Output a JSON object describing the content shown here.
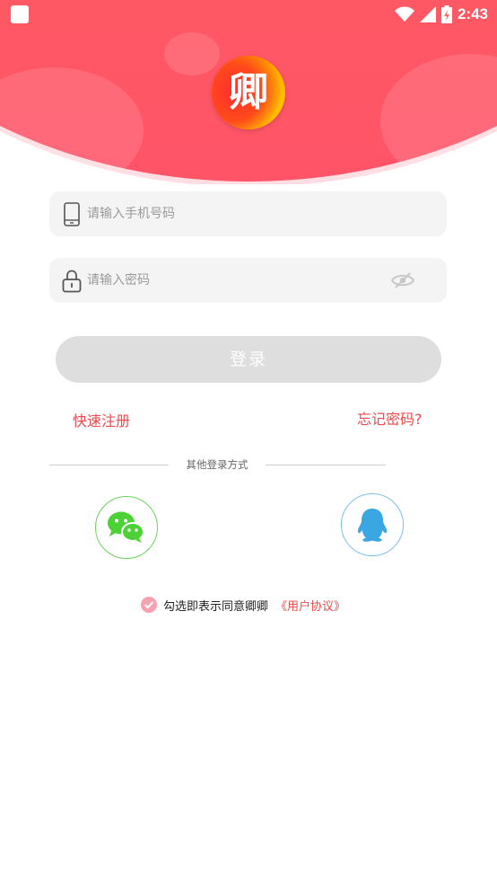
{
  "status_bar": {
    "time": "2:43"
  },
  "logo": {
    "char": "卿"
  },
  "phone_field": {
    "placeholder": "请输入手机号码",
    "value": ""
  },
  "password_field": {
    "placeholder": "请输入密码",
    "value": ""
  },
  "login_button": {
    "label": "登录"
  },
  "links": {
    "register": "快速注册",
    "forgot": "忘记密码?"
  },
  "other_login": {
    "label": "其他登录方式"
  },
  "agreement": {
    "text": "勾选即表示同意卿卿",
    "link": "《用户协议》",
    "checked": true
  },
  "colors": {
    "header_gradient_top": "#ff6a5c",
    "header_gradient_bottom": "#ff5468",
    "accent_red": "#f2484b",
    "button_disabled": "#dedede",
    "wechat_green": "#4cd137",
    "qq_blue": "#3aa7e2",
    "checkbox_pink": "#f6a2b2"
  }
}
